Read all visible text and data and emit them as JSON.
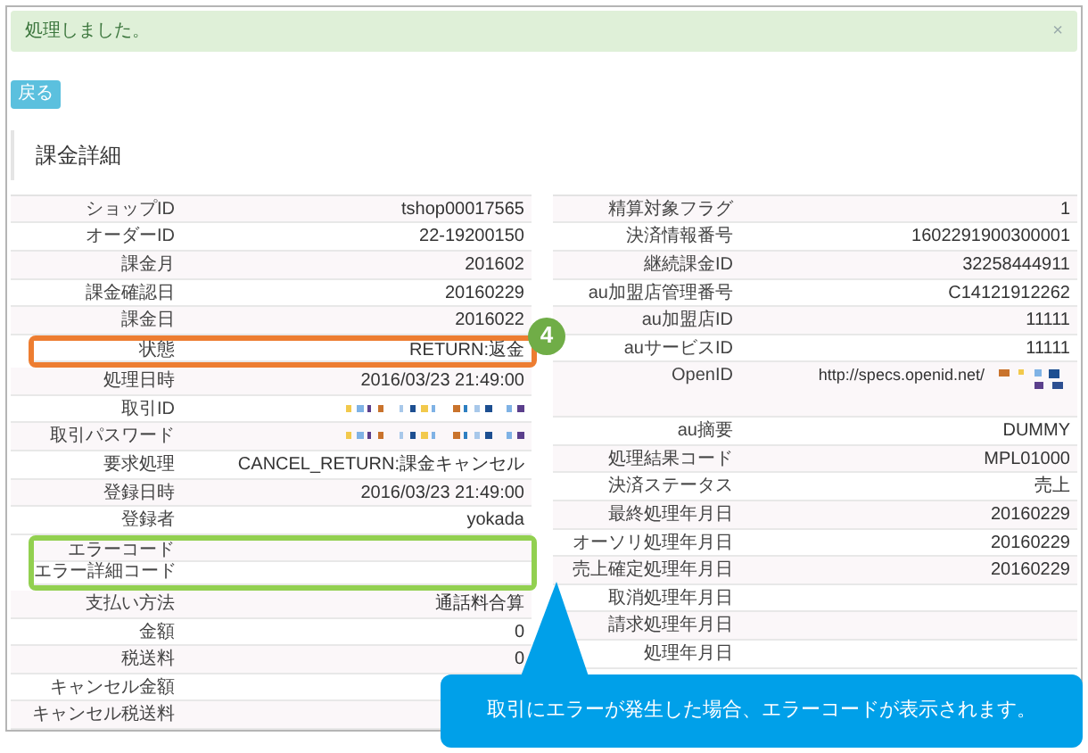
{
  "alert": {
    "message": "処理しました。",
    "close": "×"
  },
  "back_button": "戻る",
  "heading": "課金詳細",
  "left_table": [
    {
      "label": "ショップID",
      "value": "tshop00017565",
      "kind": "text"
    },
    {
      "label": "オーダーID",
      "value": "22-19200150",
      "kind": "text"
    },
    {
      "label": "課金月",
      "value": "201602",
      "kind": "text"
    },
    {
      "label": "課金確認日",
      "value": "20160229",
      "kind": "text"
    },
    {
      "label": "課金日",
      "value": "2016022",
      "kind": "text"
    },
    {
      "label": "状態",
      "value": "RETURN:返金",
      "kind": "text",
      "color": "#ed7d31",
      "step": "4"
    },
    {
      "label": "処理日時",
      "value": "2016/03/23 21:49:00",
      "kind": "text"
    },
    {
      "label": "取引ID",
      "kind": "redacted"
    },
    {
      "label": "取引パスワード",
      "kind": "redacted"
    },
    {
      "label": "要求処理",
      "value": "CANCEL_RETURN:課金キャンセル",
      "kind": "text"
    },
    {
      "label": "登録日時",
      "value": "2016/03/23 21:49:00",
      "kind": "text"
    },
    {
      "label": "登録者",
      "value": "yokada",
      "kind": "text"
    },
    {
      "label": "エラーコード",
      "kind": "empty",
      "color": "#92d050"
    },
    {
      "label": "エラー詳細コード",
      "kind": "empty",
      "color": "#92d050"
    },
    {
      "label": "支払い方法",
      "value": "通話料合算",
      "kind": "text"
    },
    {
      "label": "金額",
      "value": "0",
      "kind": "text"
    },
    {
      "label": "税送料",
      "value": "0",
      "kind": "text"
    },
    {
      "label": "キャンセル金額",
      "kind": "empty"
    },
    {
      "label": "キャンセル税送料",
      "kind": "empty"
    }
  ],
  "right_table": [
    {
      "label": "精算対象フラグ",
      "value": "1",
      "kind": "text"
    },
    {
      "label": "決済情報番号",
      "value": "1602291900300001",
      "kind": "text"
    },
    {
      "label": "継続課金ID",
      "value": "32258444911",
      "kind": "text"
    },
    {
      "label": "au加盟店管理番号",
      "value": "C14121912262",
      "kind": "text"
    },
    {
      "label": "au加盟店ID",
      "value": "11111",
      "kind": "text"
    },
    {
      "label": "auサービスID",
      "value": "11111",
      "kind": "text"
    },
    {
      "label": "OpenID",
      "value": "http://specs.openid.net/",
      "kind": "url_redacted"
    },
    {
      "label": "au摘要",
      "value": "DUMMY",
      "kind": "text"
    },
    {
      "label": "処理結果コード",
      "value": "MPL01000",
      "kind": "text"
    },
    {
      "label": "決済ステータス",
      "value": "売上",
      "kind": "text"
    },
    {
      "label": "最終処理年月日",
      "value": "20160229",
      "kind": "text"
    },
    {
      "label": "オーソリ処理年月日",
      "value": "20160229",
      "kind": "text"
    },
    {
      "label": "売上確定処理年月日",
      "value": "20160229",
      "kind": "text"
    },
    {
      "label": "取消処理年月日",
      "kind": "empty"
    },
    {
      "label": "請求処理年月日",
      "kind": "empty"
    },
    {
      "label": "処理年月日",
      "kind": "empty"
    }
  ],
  "annotation": {
    "callout": "取引にエラーが発生した場合、エラーコードが表示されます。"
  }
}
